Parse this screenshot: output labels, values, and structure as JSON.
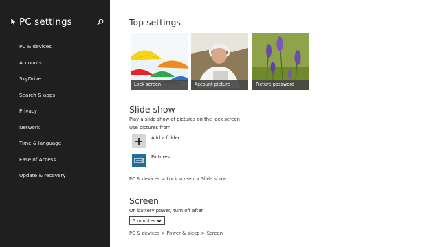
{
  "sidebar": {
    "title": "PC settings",
    "items": [
      {
        "label": "PC & devices"
      },
      {
        "label": "Accounts"
      },
      {
        "label": "SkyDrive"
      },
      {
        "label": "Search & apps"
      },
      {
        "label": "Privacy"
      },
      {
        "label": "Network"
      },
      {
        "label": "Time & language"
      },
      {
        "label": "Ease of Access"
      },
      {
        "label": "Update & recovery"
      }
    ],
    "icons": {
      "back": "cursor-arrow-icon",
      "search": "search-icon"
    }
  },
  "top_settings": {
    "heading": "Top settings",
    "tiles": [
      {
        "label": "Lock screen"
      },
      {
        "label": "Account picture"
      },
      {
        "label": "Picture password"
      }
    ]
  },
  "slide_show": {
    "heading": "Slide show",
    "description": "Play a slide show of pictures on the lock screen",
    "use_pictures_label": "Use pictures from",
    "add_folder_label": "Add a folder",
    "pictures_label": "Pictures",
    "breadcrumb": "PC & devices > Lock screen > Slide show"
  },
  "screen": {
    "heading": "Screen",
    "battery_label": "On battery power, turn off after",
    "timeout_value": "5 minutes",
    "breadcrumb": "PC & devices > Power & sleep > Screen"
  },
  "colors": {
    "sidebar_bg": "#1f1f1f",
    "tile_caption_bg": "#464646",
    "add_folder_bg": "#d6d6d6",
    "pictures_icon_bg": "#1f6e9e"
  }
}
